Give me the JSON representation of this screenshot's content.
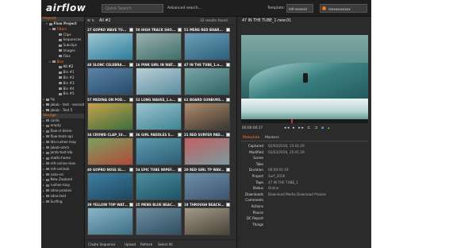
{
  "colors": {
    "accent": "#ff7a1a",
    "background": "#2b2b2b",
    "timeline_marker": "#d42b2b"
  },
  "header": {
    "logo": "airflow",
    "search_placeholder": "Quick Search",
    "advanced_search": "Advanced search...",
    "template_label": "Template:",
    "template_value": "mfr-several",
    "user_name": "mxxxxxxxxxx"
  },
  "sidebar": {
    "projects_header": "Projects",
    "project_tree": [
      {
        "label": "Flow Project",
        "indent": 1,
        "caret": "▾",
        "style": "bold"
      },
      {
        "label": "Filters",
        "indent": 2,
        "caret": "▾",
        "style": "orange"
      },
      {
        "label": "Clips",
        "indent": 4,
        "caret": ""
      },
      {
        "label": "Sequences",
        "indent": 4,
        "caret": ""
      },
      {
        "label": "Subclips",
        "indent": 4,
        "caret": ""
      },
      {
        "label": "Images",
        "indent": 4,
        "caret": ""
      },
      {
        "label": "Files",
        "indent": 4,
        "caret": ""
      },
      {
        "label": "Bins",
        "indent": 2,
        "caret": "▾",
        "style": "orange"
      },
      {
        "label": "All #2",
        "indent": 4,
        "caret": "",
        "style": "active"
      },
      {
        "label": "Bin #1",
        "indent": 4,
        "caret": ""
      },
      {
        "label": "Bin #2",
        "indent": 4,
        "caret": ""
      },
      {
        "label": "Bin #3",
        "indent": 4,
        "caret": ""
      },
      {
        "label": "Bin #4",
        "indent": 4,
        "caret": ""
      },
      {
        "label": "Bin #5",
        "indent": 4,
        "caret": ""
      },
      {
        "label": "hg",
        "indent": 0,
        "caret": "▸"
      },
      {
        "label": "jakub - test - second us",
        "indent": 0,
        "caret": "▸"
      },
      {
        "label": "jakub - Test 5",
        "indent": 0,
        "caret": "▸"
      }
    ],
    "storage_header": "Storage",
    "storage_items": [
      "cards",
      "empty",
      "flow-cl-demo",
      "flow-tests-api",
      "lda-rushes-may",
      "jakub-umm",
      "jamb-test-lda",
      "matts-home",
      "mfr-online-mov",
      "mfr-onlinek",
      "nato-src",
      "New Zealand",
      "rushes-may",
      "sdna-proxies",
      "sdna-test",
      "Surfing"
    ]
  },
  "grid": {
    "header_icons": "⊞ ⇅",
    "title": "All #2",
    "results": "32 results found",
    "tiles": [
      "27 GOPRO WAVE TU...",
      "50 HIGH TRACK SHO...",
      "51 MENS RED BOAR...",
      "48 SLONC CELEBRA...",
      "16 PINK GIRL IN WAT...",
      "47 IN THE TUBE_1.n...",
      "57 MEDINA ON POD...",
      "52 LONG WAVES_1.n...",
      "61 BOARD SUNBURS...",
      "34 CROWD CLAP_10...",
      "36 GIRL PADDLES S...",
      "21 RED SURFER PAD...",
      "40 GOPRO NOSE SL...",
      "54 EPIC TUBE WIPEF...",
      "20 RED GIRL TP WAV...",
      "39 YELLOW TOP WAT...",
      "25 MENS BLUE BEAC...",
      "18 THROUGH BEACH..."
    ],
    "footer": {
      "create_sequence": "Create Sequence",
      "upload": "Upload",
      "refresh": "Refresh",
      "select_all": "Select All"
    }
  },
  "detail": {
    "title": "47 IN THE TUBE_1.new.01",
    "timecode": "00:00:00:17",
    "progress_fraction": 0.4,
    "tabs": [
      "Metadata",
      "Markers"
    ],
    "metadata": [
      {
        "key": "Captured",
        "value": "02/03/2016, 15:41:29"
      },
      {
        "key": "Modified",
        "value": "02/03/2016, 15:41:29"
      },
      {
        "key": "Scene",
        "value": ""
      },
      {
        "key": "Take",
        "value": ""
      },
      {
        "key": "Duration",
        "value": "00:00:01:19"
      },
      {
        "key": "Project",
        "value": "Surf_2016"
      },
      {
        "key": "Tape",
        "value": "47 IN THE TUBE_1"
      },
      {
        "key": "Status",
        "value": "Online"
      },
      {
        "key": "Downloads",
        "value": "Download Media    Download Proxies"
      },
      {
        "key": "Comments",
        "value": ""
      },
      {
        "key": "Actions",
        "value": ""
      },
      {
        "key": "Places",
        "value": ""
      },
      {
        "key": "QC Report",
        "value": ""
      },
      {
        "key": "Things",
        "value": ""
      }
    ]
  }
}
